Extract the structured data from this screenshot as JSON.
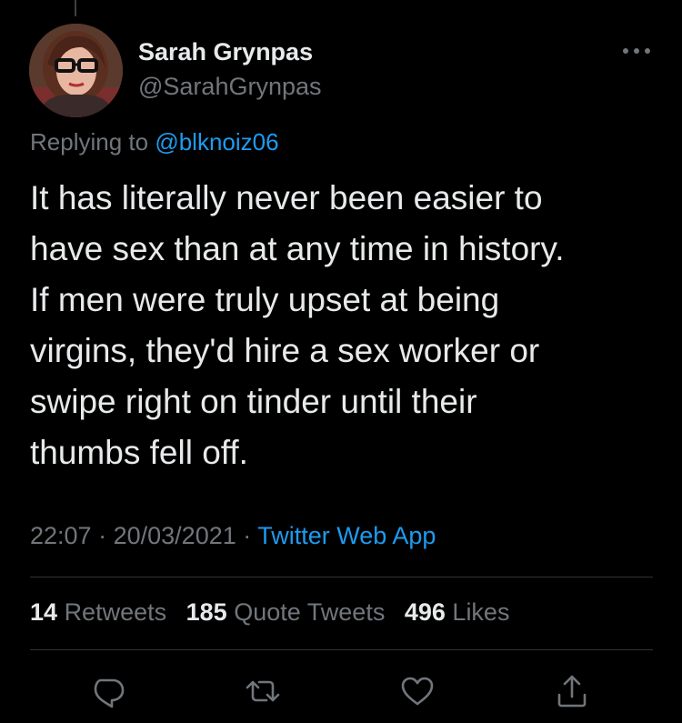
{
  "tweet": {
    "display_name": "Sarah Grynpas",
    "handle": "@SarahGrynpas",
    "replying_prefix": "Replying to",
    "replying_to": "@blknoiz06",
    "text": "It has literally never been easier to\nhave sex than at any time in history.\nIf men were truly upset at being\nvirgins, they'd hire a sex worker or\nswipe right on tinder until their\nthumbs fell off.",
    "time": "22:07",
    "date": "20/03/2021",
    "separator": "·",
    "source": "Twitter Web App"
  },
  "stats": {
    "retweets_count": "14",
    "retweets_label": "Retweets",
    "quotes_count": "185",
    "quotes_label": "Quote Tweets",
    "likes_count": "496",
    "likes_label": "Likes"
  },
  "icons": {
    "more": "more-horizontal-icon",
    "reply": "reply-icon",
    "retweet": "retweet-icon",
    "like": "heart-icon",
    "share": "share-icon"
  },
  "colors": {
    "background": "#000000",
    "text": "#e7e9ea",
    "muted": "#71767b",
    "accent": "#1d9bf0",
    "divider": "#2f3336"
  }
}
